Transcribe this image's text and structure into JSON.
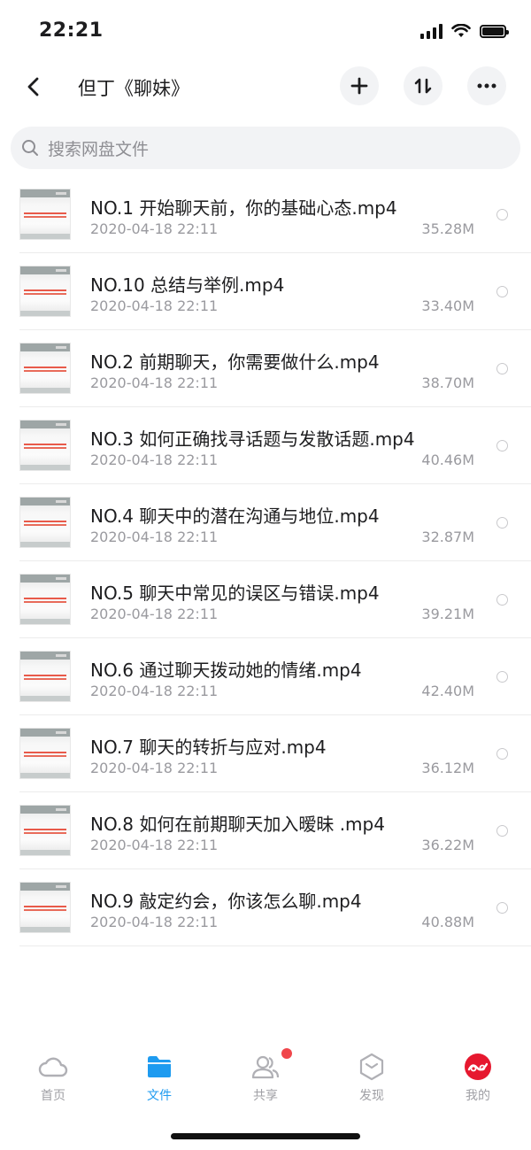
{
  "status_bar": {
    "time": "22:21"
  },
  "nav": {
    "title": "但丁《聊妹》"
  },
  "search": {
    "placeholder": "搜索网盘文件"
  },
  "files": [
    {
      "name": "NO.1 开始聊天前，你的基础心态.mp4",
      "date": "2020-04-18 22:11",
      "size": "35.28M"
    },
    {
      "name": "NO.10 总结与举例.mp4",
      "date": "2020-04-18 22:11",
      "size": "33.40M"
    },
    {
      "name": "NO.2 前期聊天，你需要做什么.mp4",
      "date": "2020-04-18 22:11",
      "size": "38.70M"
    },
    {
      "name": "NO.3 如何正确找寻话题与发散话题.mp4",
      "date": "2020-04-18 22:11",
      "size": "40.46M"
    },
    {
      "name": "NO.4 聊天中的潜在沟通与地位.mp4",
      "date": "2020-04-18 22:11",
      "size": "32.87M"
    },
    {
      "name": "NO.5 聊天中常见的误区与错误.mp4",
      "date": "2020-04-18 22:11",
      "size": "39.21M"
    },
    {
      "name": "NO.6 通过聊天拨动她的情绪.mp4",
      "date": "2020-04-18 22:11",
      "size": "42.40M"
    },
    {
      "name": "NO.7 聊天的转折与应对.mp4",
      "date": "2020-04-18 22:11",
      "size": "36.12M"
    },
    {
      "name": "NO.8 如何在前期聊天加入暧昧 .mp4",
      "date": "2020-04-18 22:11",
      "size": "36.22M"
    },
    {
      "name": "NO.9 敲定约会，你该怎么聊.mp4",
      "date": "2020-04-18 22:11",
      "size": "40.88M"
    }
  ],
  "tabs": [
    {
      "label": "首页",
      "icon": "cloud-icon"
    },
    {
      "label": "文件",
      "icon": "folder-icon",
      "active": true
    },
    {
      "label": "共享",
      "icon": "users-icon",
      "badge": true
    },
    {
      "label": "发现",
      "icon": "discover-icon"
    },
    {
      "label": "我的",
      "icon": "profile-avatar-icon"
    }
  ],
  "colors": {
    "accent": "#1e9bf0",
    "badge": "#f0464b",
    "avatar": "#e6182f"
  }
}
